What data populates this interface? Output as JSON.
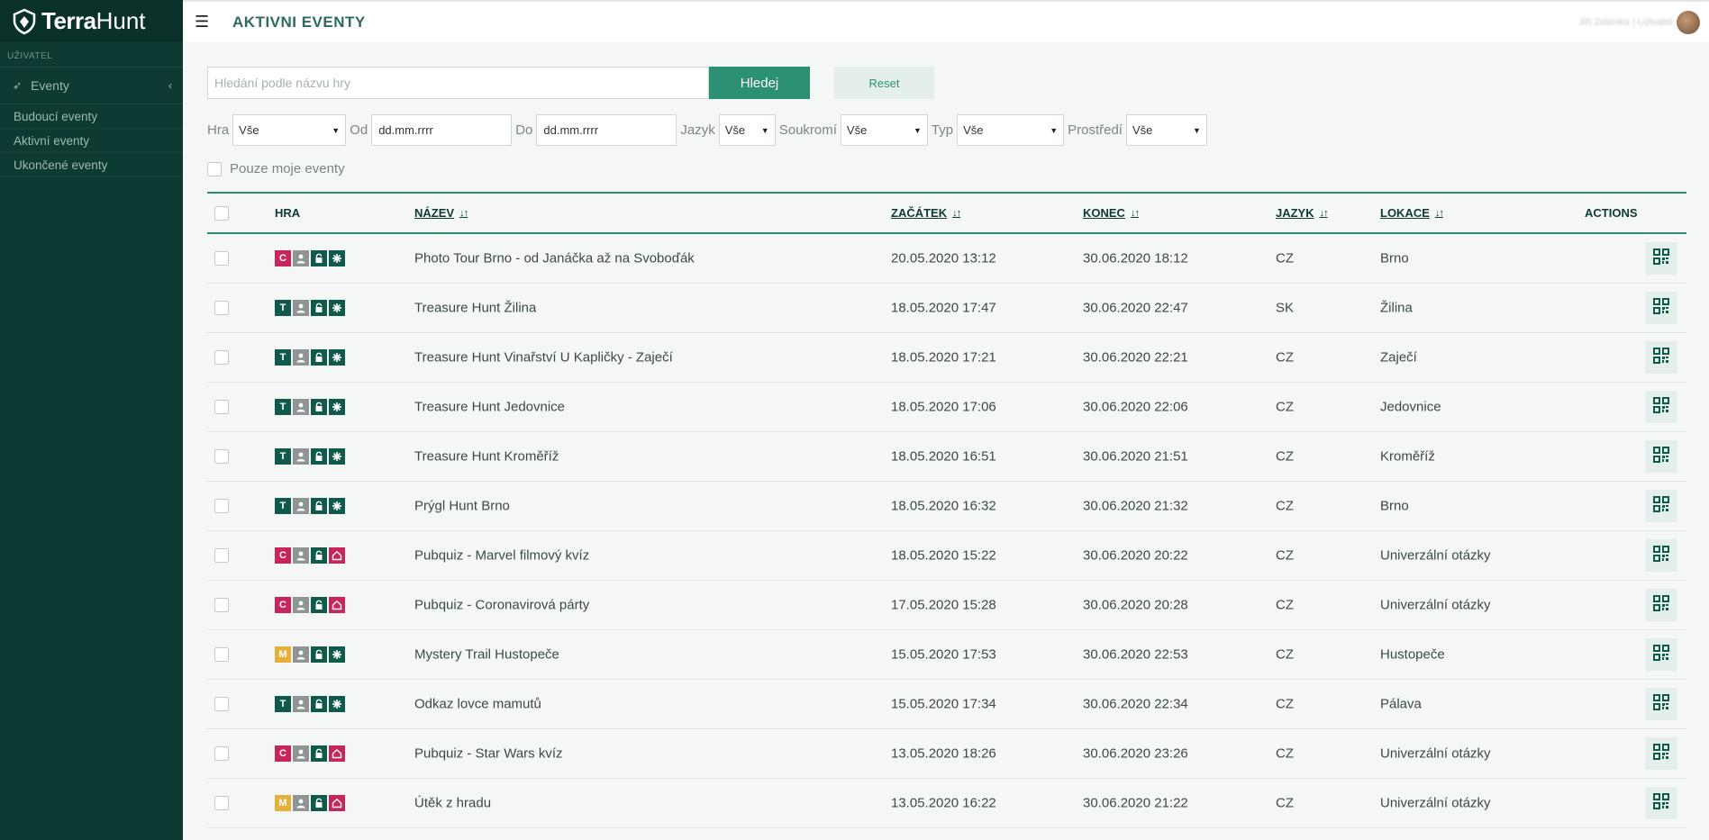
{
  "app": {
    "brand_bold": "Terra",
    "brand_light": "Hunt"
  },
  "sidebar": {
    "section_label": "UŽIVATEL",
    "menu_label": "Eventy",
    "items": [
      {
        "label": "Budoucí eventy"
      },
      {
        "label": "Aktivní eventy"
      },
      {
        "label": "Ukončené eventy"
      }
    ]
  },
  "header": {
    "title": "AKTIVNI EVENTY",
    "user_name": "Jiří Zelenka | Uživatel"
  },
  "search": {
    "placeholder": "Hledání podle názvu hry",
    "value": "",
    "search_label": "Hledej",
    "reset_label": "Reset"
  },
  "filters": {
    "hra_label": "Hra",
    "hra_value": "Vše",
    "od_label": "Od",
    "od_value": "dd.mm.rrrr",
    "do_label": "Do",
    "do_value": "dd.mm.rrrr",
    "jazyk_label": "Jazyk",
    "jazyk_value": "Vše",
    "soukromi_label": "Soukromí",
    "soukromi_value": "Vše",
    "typ_label": "Typ",
    "typ_value": "Vše",
    "prostredi_label": "Prostředí",
    "prostredi_value": "Vše",
    "mine_label": "Pouze moje eventy"
  },
  "table": {
    "headers": {
      "hra": "HRA",
      "nazev": "NÁZEV",
      "zacatek": "ZAČÁTEK",
      "konec": "KONEC",
      "jazyk": "JAZYK",
      "lokace": "LOKACE",
      "actions": "ACTIONS",
      "sort_icon": "↓↑"
    },
    "rows": [
      {
        "type": "C",
        "env": "outdoor",
        "name": "Photo Tour Brno - od Janáčka až na Svoboďák",
        "start": "20.05.2020 13:12",
        "end": "30.06.2020 18:12",
        "lang": "CZ",
        "loc": "Brno"
      },
      {
        "type": "T",
        "env": "outdoor",
        "name": "Treasure Hunt Žilina",
        "start": "18.05.2020 17:47",
        "end": "30.06.2020 22:47",
        "lang": "SK",
        "loc": "Žilina"
      },
      {
        "type": "T",
        "env": "outdoor",
        "name": "Treasure Hunt Vinařství U Kapličky - Zaječí",
        "start": "18.05.2020 17:21",
        "end": "30.06.2020 22:21",
        "lang": "CZ",
        "loc": "Zaječí"
      },
      {
        "type": "T",
        "env": "outdoor",
        "name": "Treasure Hunt Jedovnice",
        "start": "18.05.2020 17:06",
        "end": "30.06.2020 22:06",
        "lang": "CZ",
        "loc": "Jedovnice"
      },
      {
        "type": "T",
        "env": "outdoor",
        "name": "Treasure Hunt Kroměříž",
        "start": "18.05.2020 16:51",
        "end": "30.06.2020 21:51",
        "lang": "CZ",
        "loc": "Kroměříž"
      },
      {
        "type": "T",
        "env": "outdoor",
        "name": "Prýgl Hunt Brno",
        "start": "18.05.2020 16:32",
        "end": "30.06.2020 21:32",
        "lang": "CZ",
        "loc": "Brno"
      },
      {
        "type": "C",
        "env": "indoor",
        "name": "Pubquiz - Marvel filmový kvíz",
        "start": "18.05.2020 15:22",
        "end": "30.06.2020 20:22",
        "lang": "CZ",
        "loc": "Univerzální otázky"
      },
      {
        "type": "C",
        "env": "indoor",
        "name": "Pubquiz - Coronavirová párty",
        "start": "17.05.2020 15:28",
        "end": "30.06.2020 20:28",
        "lang": "CZ",
        "loc": "Univerzální otázky"
      },
      {
        "type": "M",
        "env": "outdoor",
        "name": "Mystery Trail Hustopeče",
        "start": "15.05.2020 17:53",
        "end": "30.06.2020 22:53",
        "lang": "CZ",
        "loc": "Hustopeče"
      },
      {
        "type": "T",
        "env": "outdoor",
        "name": "Odkaz lovce mamutů",
        "start": "15.05.2020 17:34",
        "end": "30.06.2020 22:34",
        "lang": "CZ",
        "loc": "Pálava"
      },
      {
        "type": "C",
        "env": "indoor",
        "name": "Pubquiz - Star Wars kvíz",
        "start": "13.05.2020 18:26",
        "end": "30.06.2020 23:26",
        "lang": "CZ",
        "loc": "Univerzální otázky"
      },
      {
        "type": "M",
        "env": "indoor",
        "name": "Útěk z hradu",
        "start": "13.05.2020 16:22",
        "end": "30.06.2020 21:22",
        "lang": "CZ",
        "loc": "Univerzální otázky"
      }
    ]
  },
  "colors": {
    "sidebar": "#0d3a32",
    "accent": "#2c9075",
    "badge_c": "#c8265a",
    "badge_t": "#0f5a4a",
    "badge_m": "#e6b03a"
  }
}
